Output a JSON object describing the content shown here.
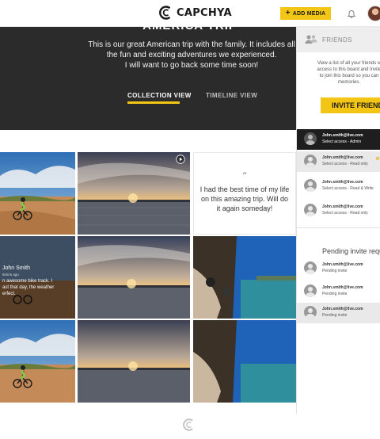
{
  "brand": {
    "name": "CAPCHYA"
  },
  "topbar": {
    "add_media_label": "ADD MEDIA",
    "add_media_icon": "plus-icon",
    "notification_icon": "bell-icon",
    "avatar_icon": "user-avatar"
  },
  "colors": {
    "accent": "#f3c515",
    "hero_bg": "#2b2b2b",
    "dark_row": "#1e1e1e"
  },
  "hero": {
    "title": "AMERICA TRIP",
    "description": "This is our great American trip with the family. It includes all\nthe fun and exciting adventures we experienced.\nI will want to go back some time soon!",
    "tabs": [
      {
        "label": "COLLECTION VIEW",
        "active": true
      },
      {
        "label": "TIMELINE VIEW",
        "active": false
      }
    ]
  },
  "grid": {
    "quote_mark": "“",
    "quote_text": "I had the best time of my life on this amazing trip. Will do it again someday!",
    "overlay": {
      "name": "John Smith",
      "time": "5mins ago",
      "text": "n awesome bike track. I\nast that day, the weather\nerfect."
    },
    "tiles": [
      "biker-photo",
      "sunset-lake-video",
      "quote-card",
      "biker-photo-overlay",
      "sunset-lake-photo",
      "boat-canal-photo",
      "biker-photo",
      "sunset-lake-photo",
      "boat-canal-photo"
    ]
  },
  "sidebar": {
    "title": "FRIENDS",
    "description": "View a list of all your friends w\naccess to this board and Invite\nto join this board so you can\nmemories.",
    "invite_label": "INVITE FRIEND",
    "friends": [
      {
        "email": "John.smith@live.com",
        "access": "Select access - Admin"
      },
      {
        "email": "John.smith@live.com",
        "access": "Select access - Read only",
        "action": "M"
      },
      {
        "email": "John.smith@live.com",
        "access": "Select access - Read & Write"
      },
      {
        "email": "John.smith@live.com",
        "access": "Select access - Read only"
      }
    ],
    "pending_title": "Pending invite requ",
    "pending": [
      {
        "email": "John.smith@live.com",
        "status": "Pending invite"
      },
      {
        "email": "John.smith@live.com",
        "status": "Pending invite"
      },
      {
        "email": "John.smith@live.com",
        "status": "Pending invite"
      }
    ]
  }
}
